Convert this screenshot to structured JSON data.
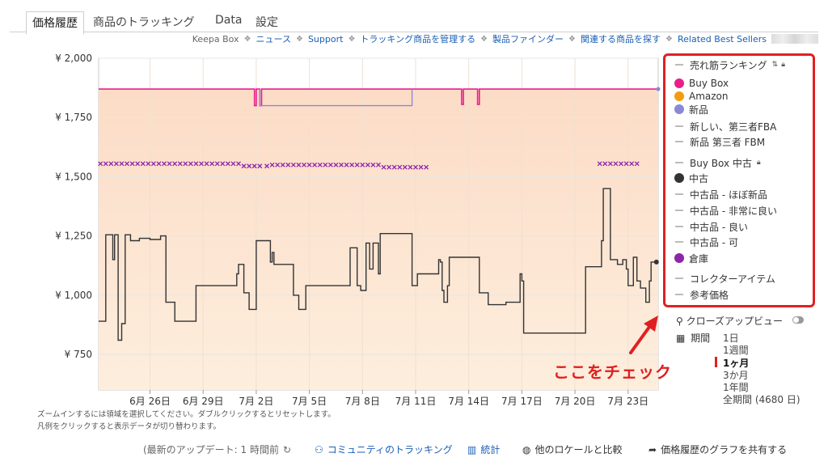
{
  "tabs": [
    "価格履歴",
    "商品のトラッキング",
    "Data",
    "設定"
  ],
  "links": {
    "lead": "Keepa Box",
    "items": [
      "ニュース",
      "Support",
      "トラッキング商品を管理する",
      "製品ファインダー",
      "関連する商品を探す",
      "Related Best Sellers"
    ]
  },
  "hint": {
    "line1": "ズームインするには領域を選択してください。ダブルクリックするとリセットします。",
    "line2": "凡例をクリックすると表示データが切り替わります。"
  },
  "legend": [
    {
      "label": "売れ筋ランキング",
      "marker": "line",
      "color": "#bbbbbb",
      "extra": "sort-icon lock-icon"
    },
    {
      "label": "Buy Box",
      "marker": "dot",
      "color": "#e91e8c"
    },
    {
      "label": "Amazon",
      "marker": "dot",
      "color": "#f39c12"
    },
    {
      "label": "新品",
      "marker": "dot",
      "color": "#8b88d8"
    },
    {
      "label": "新しい、第三者FBA",
      "marker": "line",
      "color": "#bbbbbb"
    },
    {
      "label": "新品 第三者 FBM",
      "marker": "line",
      "color": "#bbbbbb"
    },
    {
      "label": "Buy Box 中古",
      "marker": "line",
      "color": "#bbbbbb",
      "extra": "lock-icon"
    },
    {
      "label": "中古",
      "marker": "dot",
      "color": "#333333"
    },
    {
      "label": "中古品 - ほぼ新品",
      "marker": "line",
      "color": "#bbbbbb"
    },
    {
      "label": "中古品 - 非常に良い",
      "marker": "line",
      "color": "#bbbbbb"
    },
    {
      "label": "中古品 - 良い",
      "marker": "line",
      "color": "#bbbbbb"
    },
    {
      "label": "中古品 - 可",
      "marker": "line",
      "color": "#bbbbbb"
    },
    {
      "label": "倉庫",
      "marker": "dot",
      "color": "#8e24aa"
    },
    {
      "label": "コレクターアイテム",
      "marker": "line",
      "color": "#bbbbbb"
    },
    {
      "label": "参考価格",
      "marker": "line",
      "color": "#bbbbbb"
    }
  ],
  "closeup": "クローズアップビュー",
  "period": {
    "label": "期間",
    "ranges": [
      "1日",
      "1週間",
      "1ヶ月",
      "3か月",
      "1年間",
      "全期間 (4680 日)"
    ],
    "selected": "1ヶ月"
  },
  "annotation": "ここをチェック",
  "bottom": {
    "updated": "(最新のアップデート: 1 時間前",
    "community": "コミュニティのトラッキング",
    "stats": "統計",
    "compare": "他のロケールと比較",
    "share": "価格履歴のグラフを共有する"
  },
  "colors": {
    "highlight": "#e02020",
    "link": "#1a5fb4",
    "buybox": "#e91e8c",
    "new": "#8b88d8",
    "used": "#333333",
    "warehouse": "#8e24aa"
  },
  "chart_data": {
    "type": "line",
    "y_ticks": [
      "¥ 2,000",
      "¥ 1,750",
      "¥ 1,500",
      "¥ 1,250",
      "¥ 1,000",
      "¥ 750"
    ],
    "ylim": [
      600,
      2000
    ],
    "x_ticks": [
      "6月 26日",
      "6月 29日",
      "7月 2日",
      "7月 5日",
      "7月 8日",
      "7月 11日",
      "7月 14日",
      "7月 17日",
      "7月 20日",
      "7月 23日"
    ],
    "x_tick_days": [
      26,
      29,
      32,
      35,
      38,
      41,
      44,
      47,
      50,
      53
    ],
    "xlim": [
      23.1,
      54.7
    ],
    "series": [
      {
        "name": "Buy Box",
        "color": "#e91e8c",
        "points": [
          [
            23.1,
            1870
          ],
          [
            31.9,
            1870
          ],
          [
            31.9,
            1800
          ],
          [
            32.0,
            1800
          ],
          [
            32.0,
            1870
          ],
          [
            32.2,
            1870
          ],
          [
            32.2,
            1800
          ],
          [
            32.3,
            1800
          ],
          [
            32.3,
            1870
          ],
          [
            43.6,
            1870
          ],
          [
            43.6,
            1805
          ],
          [
            43.7,
            1805
          ],
          [
            43.7,
            1870
          ],
          [
            44.5,
            1870
          ],
          [
            44.5,
            1805
          ],
          [
            44.6,
            1805
          ],
          [
            44.6,
            1870
          ],
          [
            54.7,
            1870
          ]
        ]
      },
      {
        "name": "新品",
        "color": "#8b88d8",
        "points": [
          [
            32.2,
            1870
          ],
          [
            32.2,
            1800
          ],
          [
            40.8,
            1800
          ],
          [
            40.8,
            1870
          ]
        ]
      },
      {
        "name": "倉庫",
        "color": "#8e24aa",
        "marker": "x",
        "points": [
          [
            23.2,
            1555
          ],
          [
            23.5,
            1555
          ],
          [
            23.8,
            1555
          ],
          [
            24.1,
            1555
          ],
          [
            24.4,
            1555
          ],
          [
            24.7,
            1555
          ],
          [
            25.0,
            1555
          ],
          [
            25.3,
            1555
          ],
          [
            25.6,
            1555
          ],
          [
            25.9,
            1555
          ],
          [
            26.2,
            1555
          ],
          [
            26.5,
            1555
          ],
          [
            26.8,
            1555
          ],
          [
            27.1,
            1555
          ],
          [
            27.4,
            1555
          ],
          [
            27.7,
            1555
          ],
          [
            28.0,
            1555
          ],
          [
            28.3,
            1555
          ],
          [
            28.6,
            1555
          ],
          [
            28.9,
            1555
          ],
          [
            29.2,
            1555
          ],
          [
            29.5,
            1555
          ],
          [
            29.8,
            1555
          ],
          [
            30.1,
            1555
          ],
          [
            30.4,
            1555
          ],
          [
            30.7,
            1555
          ],
          [
            31.0,
            1555
          ],
          [
            31.3,
            1545
          ],
          [
            31.6,
            1545
          ],
          [
            31.9,
            1545
          ],
          [
            32.2,
            1545
          ],
          [
            32.6,
            1545
          ],
          [
            32.9,
            1550
          ],
          [
            33.2,
            1550
          ],
          [
            33.5,
            1550
          ],
          [
            33.8,
            1550
          ],
          [
            34.1,
            1550
          ],
          [
            34.4,
            1550
          ],
          [
            34.7,
            1550
          ],
          [
            35.0,
            1550
          ],
          [
            35.3,
            1550
          ],
          [
            35.6,
            1550
          ],
          [
            35.9,
            1550
          ],
          [
            36.2,
            1550
          ],
          [
            36.5,
            1550
          ],
          [
            36.8,
            1550
          ],
          [
            37.1,
            1550
          ],
          [
            37.4,
            1550
          ],
          [
            37.7,
            1550
          ],
          [
            38.0,
            1550
          ],
          [
            38.3,
            1550
          ],
          [
            38.6,
            1550
          ],
          [
            38.9,
            1550
          ],
          [
            39.2,
            1540
          ],
          [
            39.5,
            1540
          ],
          [
            39.8,
            1540
          ],
          [
            40.1,
            1540
          ],
          [
            40.4,
            1540
          ],
          [
            40.7,
            1540
          ],
          [
            41.0,
            1540
          ],
          [
            41.3,
            1540
          ],
          [
            41.6,
            1540
          ],
          [
            51.4,
            1555
          ],
          [
            51.7,
            1555
          ],
          [
            52.0,
            1555
          ],
          [
            52.3,
            1555
          ],
          [
            52.6,
            1555
          ],
          [
            52.9,
            1555
          ],
          [
            53.2,
            1555
          ],
          [
            53.5,
            1555
          ]
        ]
      },
      {
        "name": "中古",
        "color": "#333333",
        "points": [
          [
            23.1,
            890
          ],
          [
            23.5,
            890
          ],
          [
            23.5,
            1255
          ],
          [
            23.9,
            1255
          ],
          [
            23.9,
            1150
          ],
          [
            24.0,
            1150
          ],
          [
            24.0,
            1255
          ],
          [
            24.2,
            1255
          ],
          [
            24.2,
            810
          ],
          [
            24.4,
            810
          ],
          [
            24.4,
            880
          ],
          [
            24.6,
            880
          ],
          [
            24.6,
            1255
          ],
          [
            24.9,
            1255
          ],
          [
            24.9,
            1230
          ],
          [
            25.4,
            1230
          ],
          [
            25.4,
            1240
          ],
          [
            26.0,
            1240
          ],
          [
            26.0,
            1235
          ],
          [
            26.6,
            1235
          ],
          [
            26.6,
            1250
          ],
          [
            26.9,
            1250
          ],
          [
            26.9,
            970
          ],
          [
            27.4,
            970
          ],
          [
            27.4,
            890
          ],
          [
            28.2,
            890
          ],
          [
            28.2,
            890
          ],
          [
            28.6,
            890
          ],
          [
            28.6,
            1040
          ],
          [
            30.9,
            1040
          ],
          [
            30.9,
            1090
          ],
          [
            31.0,
            1090
          ],
          [
            31.0,
            1130
          ],
          [
            31.3,
            1130
          ],
          [
            31.3,
            1010
          ],
          [
            31.6,
            1010
          ],
          [
            31.6,
            940
          ],
          [
            32.0,
            940
          ],
          [
            32.0,
            1230
          ],
          [
            32.6,
            1230
          ],
          [
            32.6,
            1230
          ],
          [
            32.8,
            1230
          ],
          [
            32.8,
            1140
          ],
          [
            32.9,
            1140
          ],
          [
            32.9,
            1180
          ],
          [
            33.0,
            1180
          ],
          [
            33.0,
            1130
          ],
          [
            34.1,
            1130
          ],
          [
            34.1,
            1000
          ],
          [
            34.4,
            1000
          ],
          [
            34.4,
            940
          ],
          [
            34.8,
            940
          ],
          [
            34.8,
            1040
          ],
          [
            37.3,
            1040
          ],
          [
            37.3,
            1200
          ],
          [
            37.7,
            1200
          ],
          [
            37.7,
            1040
          ],
          [
            37.9,
            1040
          ],
          [
            37.9,
            1020
          ],
          [
            38.2,
            1020
          ],
          [
            38.2,
            1220
          ],
          [
            38.4,
            1220
          ],
          [
            38.4,
            1110
          ],
          [
            38.6,
            1110
          ],
          [
            38.6,
            1220
          ],
          [
            38.9,
            1220
          ],
          [
            38.9,
            1090
          ],
          [
            39.0,
            1090
          ],
          [
            39.0,
            1260
          ],
          [
            40.8,
            1260
          ],
          [
            40.8,
            1040
          ],
          [
            41.1,
            1040
          ],
          [
            41.1,
            1090
          ],
          [
            42.3,
            1090
          ],
          [
            42.3,
            1150
          ],
          [
            42.4,
            1150
          ],
          [
            42.4,
            1140
          ],
          [
            42.5,
            1140
          ],
          [
            42.5,
            1020
          ],
          [
            42.6,
            1020
          ],
          [
            42.6,
            970
          ],
          [
            42.8,
            970
          ],
          [
            42.8,
            1040
          ],
          [
            42.9,
            1040
          ],
          [
            42.9,
            1160
          ],
          [
            44.6,
            1160
          ],
          [
            44.6,
            1010
          ],
          [
            45.1,
            1010
          ],
          [
            45.1,
            960
          ],
          [
            46.1,
            960
          ],
          [
            46.1,
            970
          ],
          [
            46.9,
            970
          ],
          [
            46.9,
            1090
          ],
          [
            47.0,
            1090
          ],
          [
            47.0,
            1060
          ],
          [
            47.1,
            1060
          ],
          [
            47.1,
            840
          ],
          [
            50.6,
            840
          ],
          [
            50.6,
            1120
          ],
          [
            51.5,
            1120
          ],
          [
            51.5,
            1230
          ],
          [
            51.6,
            1230
          ],
          [
            51.6,
            1450
          ],
          [
            52.0,
            1450
          ],
          [
            52.0,
            1150
          ],
          [
            52.4,
            1150
          ],
          [
            52.4,
            1130
          ],
          [
            52.7,
            1130
          ],
          [
            52.7,
            1150
          ],
          [
            52.9,
            1150
          ],
          [
            52.9,
            1110
          ],
          [
            53.0,
            1110
          ],
          [
            53.0,
            1040
          ],
          [
            53.3,
            1040
          ],
          [
            53.3,
            1160
          ],
          [
            53.5,
            1160
          ],
          [
            53.5,
            1060
          ],
          [
            53.7,
            1060
          ],
          [
            53.7,
            1030
          ],
          [
            54.0,
            1030
          ],
          [
            54.0,
            970
          ],
          [
            54.2,
            970
          ],
          [
            54.2,
            1060
          ],
          [
            54.3,
            1060
          ],
          [
            54.3,
            1140
          ],
          [
            54.6,
            1140
          ]
        ]
      }
    ]
  }
}
